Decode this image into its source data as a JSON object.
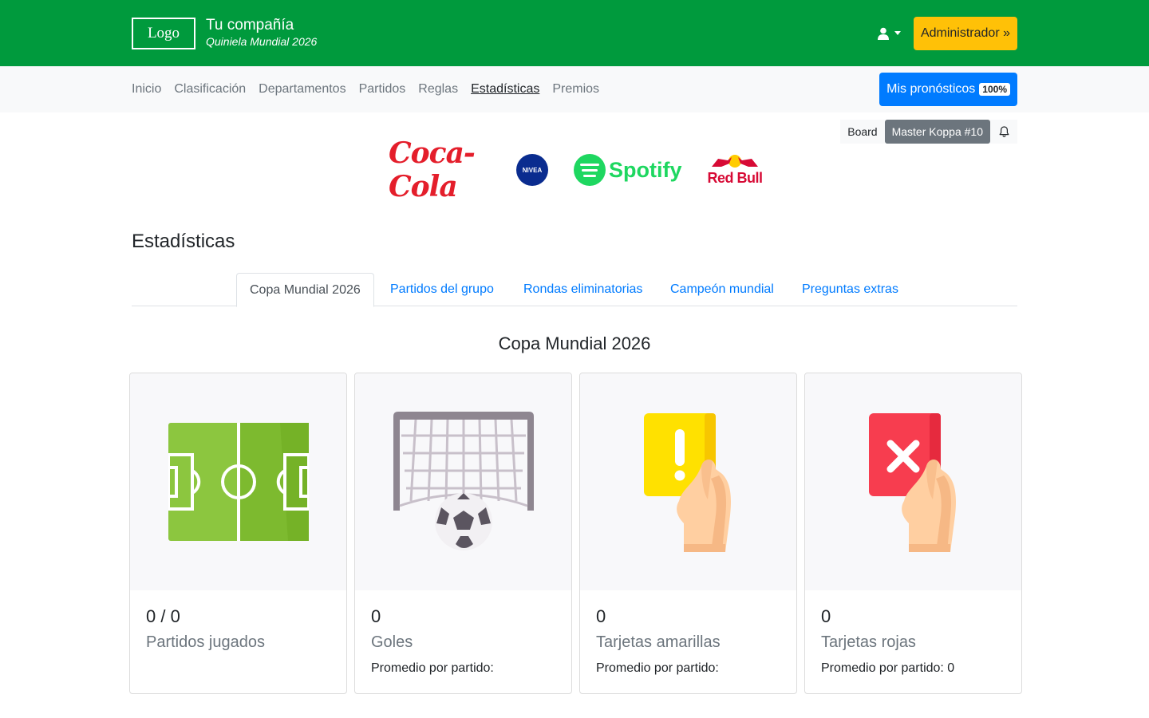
{
  "header": {
    "logo_text": "Logo",
    "company": "Tu compañía",
    "subtitle": "Quiniela Mundial 2026",
    "admin_label": "Administrador »"
  },
  "nav": {
    "items": [
      {
        "label": "Inicio"
      },
      {
        "label": "Clasificación"
      },
      {
        "label": "Departamentos"
      },
      {
        "label": "Partidos"
      },
      {
        "label": "Reglas"
      },
      {
        "label": "Estadísticas",
        "active": true
      },
      {
        "label": "Premios"
      }
    ],
    "predictions_label": "Mis pronósticos",
    "predictions_pct": "100%"
  },
  "board": {
    "board_label": "Board",
    "league_label": "Master Koppa #10",
    "bell_icon": "bell-icon"
  },
  "sponsors": {
    "cocacola": "Coca-Cola",
    "nivea": "NIVEA",
    "spotify": "Spotify",
    "redbull": "Red Bull"
  },
  "page": {
    "title": "Estadísticas",
    "tabs": [
      {
        "label": "Copa Mundial 2026",
        "active": true
      },
      {
        "label": "Partidos del grupo"
      },
      {
        "label": "Rondas eliminatorias"
      },
      {
        "label": "Campeón mundial"
      },
      {
        "label": "Preguntas extras"
      }
    ],
    "section_title": "Copa Mundial 2026"
  },
  "cards": [
    {
      "icon": "soccer-field-icon",
      "value": "0 / 0",
      "label": "Partidos jugados",
      "avg": ""
    },
    {
      "icon": "goal-net-icon",
      "value": "0",
      "label": "Goles",
      "avg": "Promedio por partido:"
    },
    {
      "icon": "yellow-card-icon",
      "value": "0",
      "label": "Tarjetas amarillas",
      "avg": "Promedio por partido:"
    },
    {
      "icon": "red-card-icon",
      "value": "0",
      "label": "Tarjetas rojas",
      "avg": "Promedio por partido: 0"
    }
  ],
  "colors": {
    "header_green": "#009a3d",
    "admin_yellow": "#ffc107",
    "primary_blue": "#007bff"
  }
}
